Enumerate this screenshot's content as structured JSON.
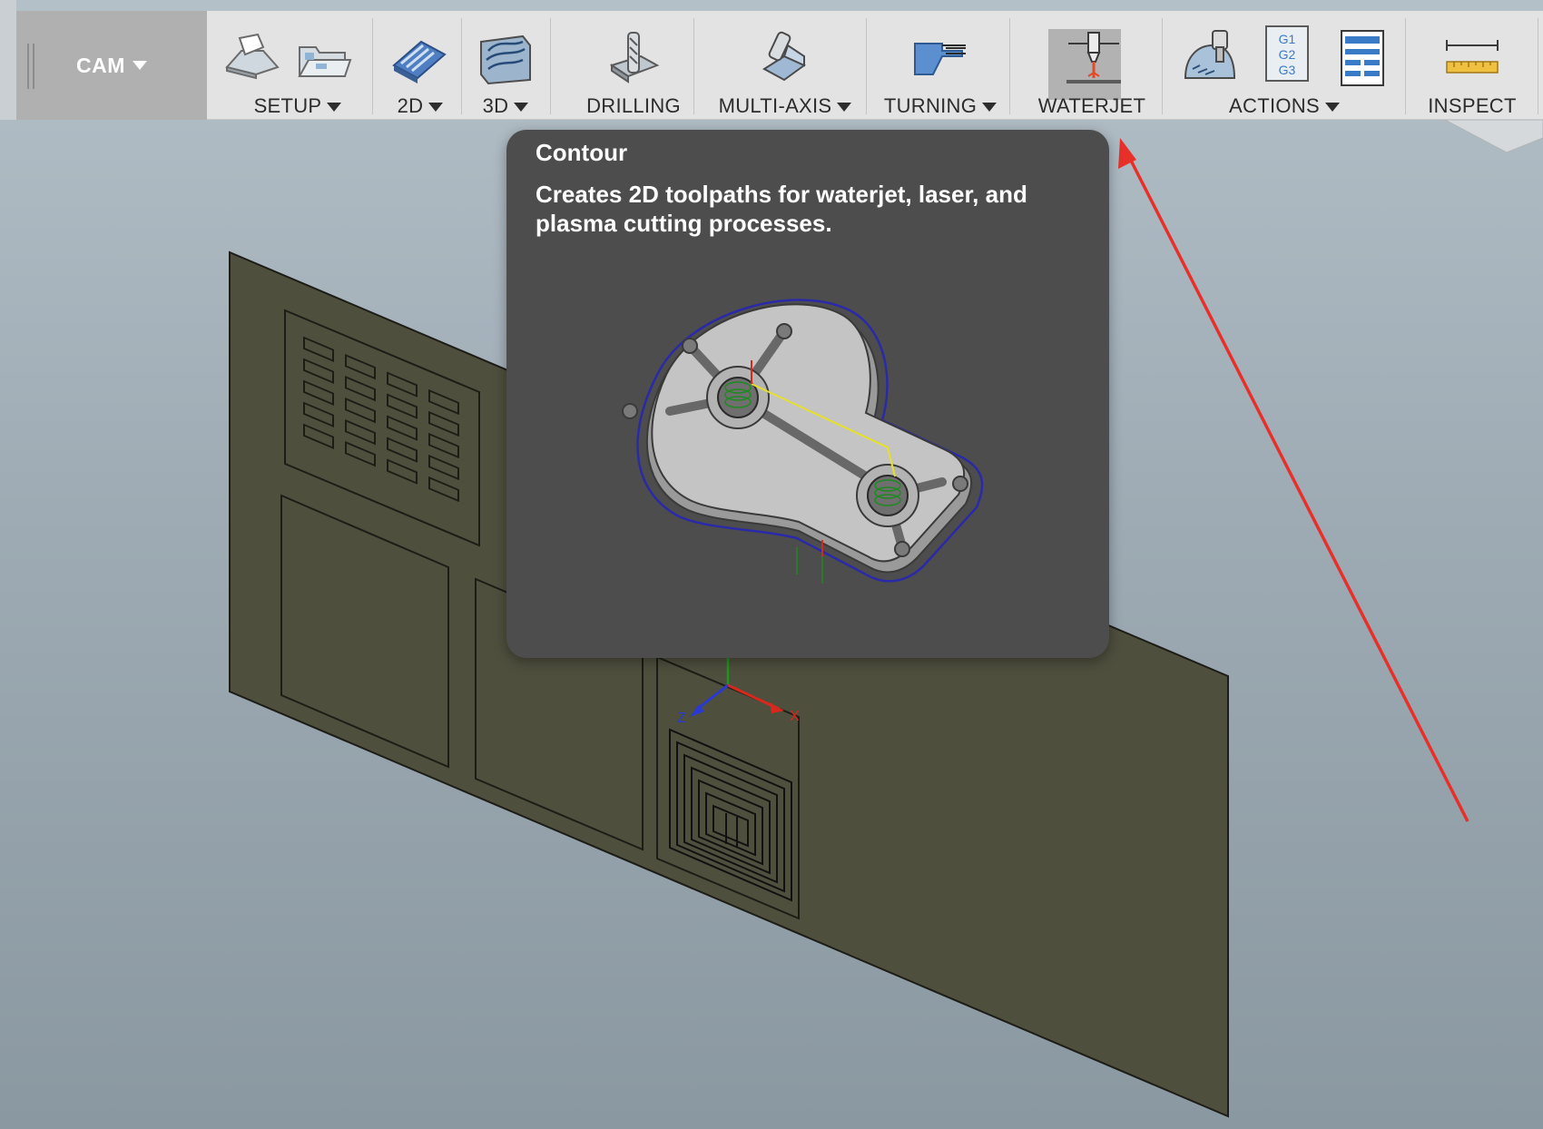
{
  "toolbar": {
    "workspace_label": "CAM",
    "groups": [
      {
        "label": "SETUP",
        "dropdown": true
      },
      {
        "label": "2D",
        "dropdown": true
      },
      {
        "label": "3D",
        "dropdown": true
      },
      {
        "label": "DRILLING",
        "dropdown": false
      },
      {
        "label": "MULTI-AXIS",
        "dropdown": true
      },
      {
        "label": "TURNING",
        "dropdown": true
      },
      {
        "label": "WATERJET",
        "dropdown": false
      },
      {
        "label": "ACTIONS",
        "dropdown": true
      },
      {
        "label": "INSPECT",
        "dropdown": false
      }
    ],
    "gcode_icon_text": [
      "G1",
      "G2",
      "G3"
    ]
  },
  "tooltip": {
    "title": "Contour",
    "description": "Creates 2D toolpaths for waterjet, laser, and plasma cutting processes."
  },
  "viewport": {
    "axis_labels": {
      "x": "X",
      "z": "Z"
    }
  },
  "colors": {
    "toolbar_bg": "#e3e3e3",
    "workspace_bg": "#b0b0b0",
    "tooltip_bg": "#4d4d4d",
    "plate": "#4f4f3e",
    "annotation_arrow": "#e8302a",
    "active_tool_bg": "#b2b2b2"
  },
  "icons": [
    "setup-icon",
    "setup-sheet-icon",
    "2d-pocket-icon",
    "3d-adaptive-icon",
    "drill-icon",
    "multi-axis-icon",
    "turning-icon",
    "waterjet-icon",
    "simulate-icon",
    "post-process-icon",
    "setup-sheet-report-icon",
    "measure-icon"
  ]
}
